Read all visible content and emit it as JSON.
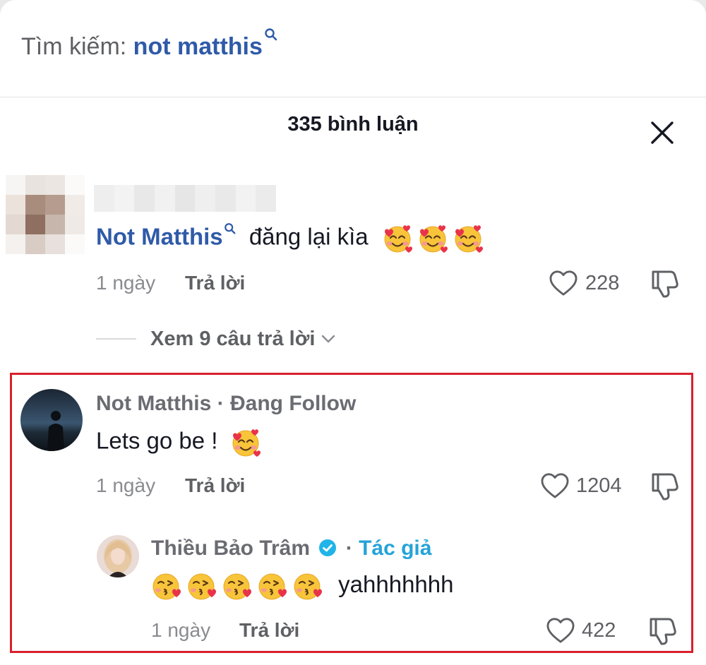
{
  "search": {
    "prefix": "Tìm kiếm: ",
    "query": "not matthis",
    "icon": "search-icon"
  },
  "header": {
    "title": "335 bình luận",
    "close_icon": "close-icon"
  },
  "comments": [
    {
      "mention": "Not Matthis",
      "text": " đăng lại kìa",
      "emojis": [
        "smiling-face-with-hearts",
        "smiling-face-with-hearts",
        "smiling-face-with-hearts"
      ],
      "time": "1 ngày",
      "reply_label": "Trả lời",
      "likes": "228",
      "view_replies": "Xem 9 câu trả lời"
    },
    {
      "author": "Not Matthis",
      "follow_status": " · Đang Follow",
      "text": "Lets go be !",
      "emojis": [
        "smiling-face-with-hearts"
      ],
      "time": "1 ngày",
      "reply_label": "Trả lời",
      "likes": "1204",
      "replies": [
        {
          "author": "Thiều Bảo Trâm",
          "creator_tag": "Tác giả",
          "separator": "·",
          "emojis": [
            "face-blowing-kiss",
            "face-blowing-kiss",
            "face-blowing-kiss",
            "face-blowing-kiss",
            "face-blowing-kiss"
          ],
          "text": "yahhhhhhh",
          "time": "1 ngày",
          "reply_label": "Trả lời",
          "likes": "422"
        }
      ]
    }
  ],
  "colors": {
    "link_blue": "#2f5aa8",
    "creator_blue": "#25a3d8",
    "highlight_red": "#d8202c",
    "verified_blue": "#20b4e8"
  }
}
